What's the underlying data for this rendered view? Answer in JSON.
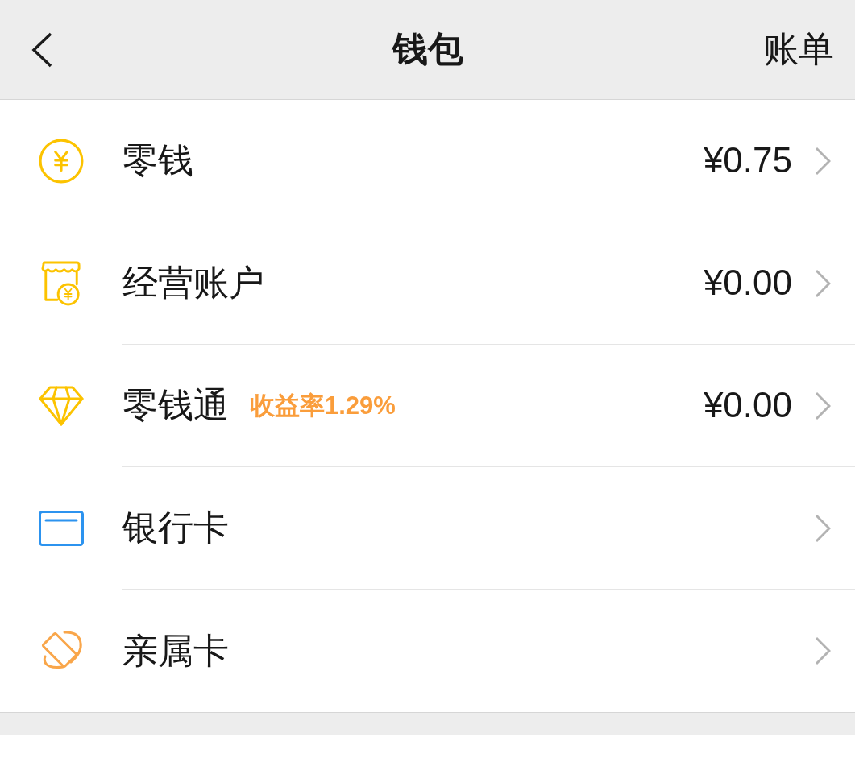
{
  "header": {
    "title": "钱包",
    "action": "账单"
  },
  "items": [
    {
      "kind": "coin",
      "color": "#fcc300",
      "label": "零钱",
      "amount": "¥0.75"
    },
    {
      "kind": "shop",
      "color": "#fcc300",
      "label": "经营账户",
      "amount": "¥0.00"
    },
    {
      "kind": "diamond",
      "color": "#fcc300",
      "label": "零钱通",
      "badge": "收益率1.29%",
      "amount": "¥0.00"
    },
    {
      "kind": "card",
      "color": "#2c93ef",
      "label": "银行卡"
    },
    {
      "kind": "family",
      "color": "#f9a64a",
      "label": "亲属卡"
    }
  ]
}
